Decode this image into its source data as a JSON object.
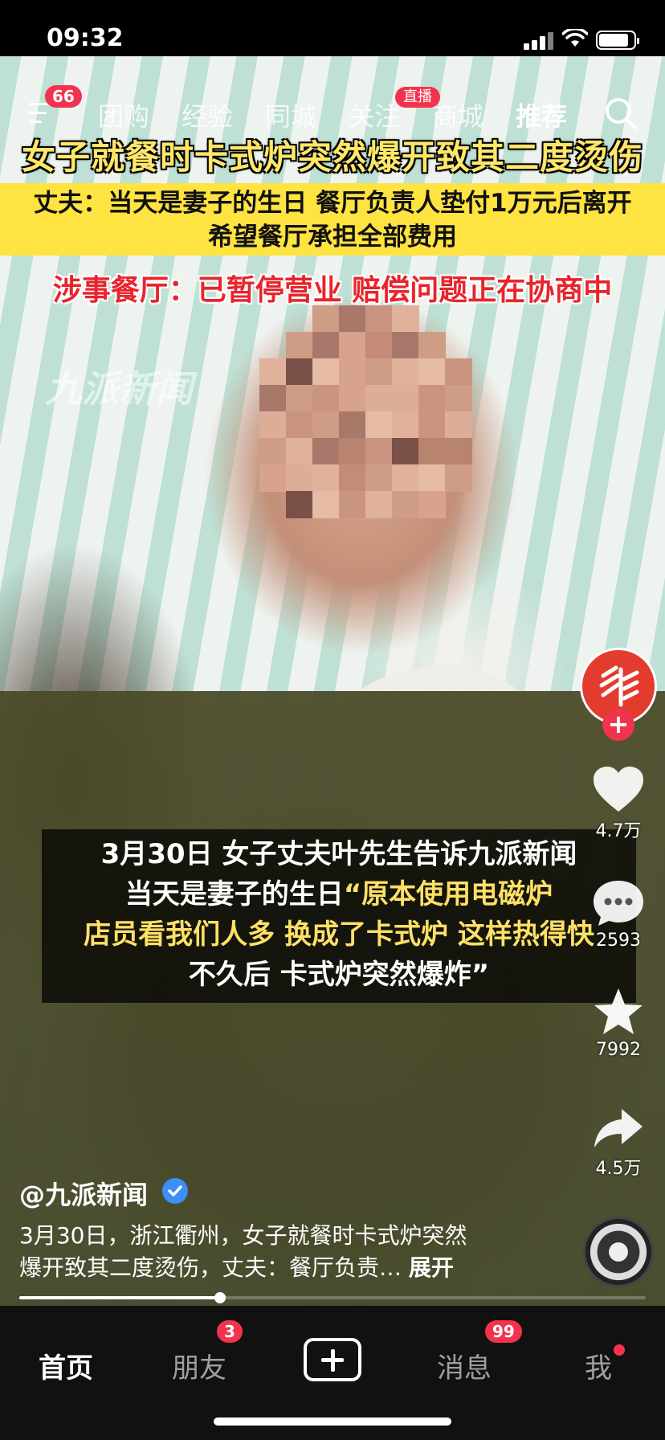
{
  "status_bar": {
    "time": "09:32"
  },
  "top_nav": {
    "menu_badge": "66",
    "tabs": [
      {
        "label": "团购",
        "active": false
      },
      {
        "label": "经验",
        "active": false
      },
      {
        "label": "同城",
        "active": false
      },
      {
        "label": "关注",
        "active": false
      },
      {
        "label": "商城",
        "active": false
      },
      {
        "label": "推荐",
        "active": true
      }
    ],
    "live_badge": "直播"
  },
  "overlay": {
    "headline": "女子就餐时卡式炉突然爆开致其二度烫伤",
    "subline_1": "丈夫：当天是妻子的生日 餐厅负责人垫付1万元后离开",
    "subline_2": "希望餐厅承担全部费用",
    "subline_3": "涉事餐厅：已暂停营业 赔偿问题正在协商中",
    "watermark": "九派新闻"
  },
  "caption": {
    "line_1": "3月30日 女子丈夫叶先生告诉九派新闻",
    "line_2_white": "当天是妻子的生日",
    "line_2_yellow": "“原本使用电磁炉",
    "line_3": "店员看我们人多 换成了卡式炉 这样热得快",
    "line_4": "不久后 卡式炉突然爆炸”"
  },
  "actions": {
    "like_count": "4.7万",
    "comment_count": "2593",
    "favorite_count": "7992",
    "share_count": "4.5万",
    "follow_plus": "+"
  },
  "post": {
    "author": "@九派新闻",
    "description_line_1": "3月30日，浙江衢州，女子就餐时卡式炉突然",
    "description_line_2": "爆开致其二度烫伤，丈夫：餐厅负责…",
    "expand_label": "展开",
    "progress_fraction": 0.32
  },
  "tab_bar": {
    "home": "首页",
    "friends": "朋友",
    "friends_badge": "3",
    "messages": "消息",
    "messages_badge": "99",
    "me": "我"
  },
  "colors": {
    "accent_red": "#f2334d",
    "headline_yellow": "#ffe66a",
    "band_yellow": "#ffe340",
    "alert_red": "#e8242c"
  }
}
